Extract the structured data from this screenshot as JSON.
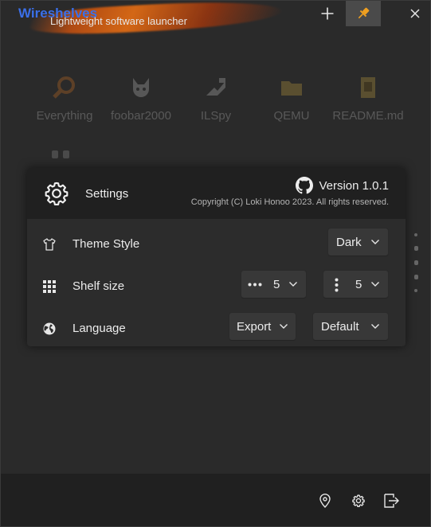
{
  "titlebar": {
    "title": "Wireshelves",
    "subtitle": "Lightweight software launcher",
    "accent": "#3b6fe8",
    "pin_color": "#f0a020",
    "buttons": [
      "plus-icon",
      "pin-icon",
      "close-icon"
    ]
  },
  "shelf": {
    "items": [
      {
        "label": "Everything",
        "icon": "search-icon",
        "color": "#e07a20"
      },
      {
        "label": "foobar2000",
        "icon": "foobar-icon",
        "color": "#cccccc"
      },
      {
        "label": "ILSpy",
        "icon": "ilspy-icon",
        "color": "#cccccc"
      },
      {
        "label": "QEMU",
        "icon": "folder-icon",
        "color": "#d8b040"
      },
      {
        "label": "README.md",
        "icon": "document-icon",
        "color": "#d8b040"
      }
    ]
  },
  "settings": {
    "title": "Settings",
    "version": "Version 1.0.1",
    "copyright": "Copyright (C) Loki Honoo 2023. All rights reserved.",
    "rows": {
      "theme": {
        "label": "Theme Style",
        "value": "Dark",
        "icon": "shirt-icon"
      },
      "shelf_size": {
        "label": "Shelf size",
        "icon": "grid-icon",
        "columns": "5",
        "rows": "5"
      },
      "language": {
        "label": "Language",
        "icon": "globe-icon",
        "export_label": "Export",
        "value": "Default"
      }
    }
  },
  "bottombar": {
    "buttons": [
      "location-icon",
      "settings-icon",
      "exit-icon"
    ]
  }
}
